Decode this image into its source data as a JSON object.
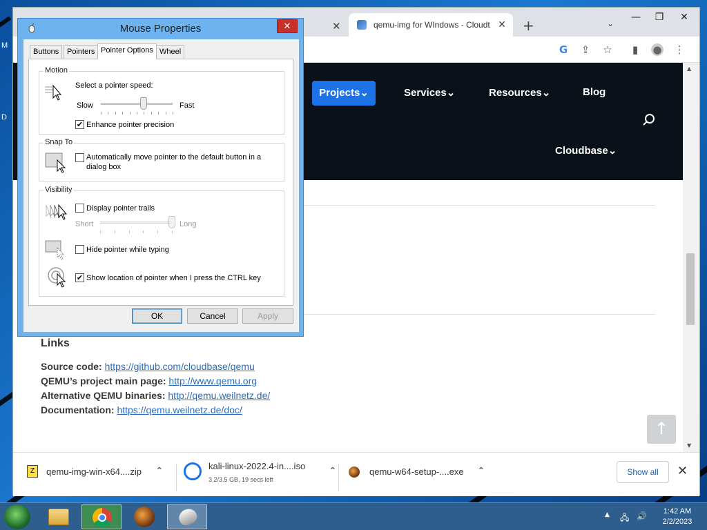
{
  "desktop": {
    "edge_labels": [
      "M",
      "D"
    ]
  },
  "browser": {
    "active_tab_title": "qemu-img for WIndows - Cloudt",
    "colors": {
      "nav_bg": "#0b1118",
      "accent": "#1d72e8",
      "link": "#2a6ebb"
    }
  },
  "site": {
    "nav": {
      "projects": "Projects",
      "services": "Services",
      "resources": "Resources",
      "blog": "Blog",
      "cloudbase": "Cloudbase"
    },
    "links_heading": "Links",
    "links": [
      {
        "label": "Source code:",
        "url": "https://github.com/cloudbase/qemu"
      },
      {
        "label": "QEMU’s project main page:",
        "url": "http://www.qemu.org"
      },
      {
        "label": "Alternative QEMU binaries:",
        "url": "http://qemu.weilnetz.de/"
      },
      {
        "label": "Documentation:",
        "url": "https://qemu.weilnetz.de/doc/"
      }
    ]
  },
  "downloads": {
    "items": [
      {
        "name": "qemu-img-win-x64....zip",
        "status": ""
      },
      {
        "name": "kali-linux-2022.4-in....iso",
        "status": "3.2/3.5 GB, 19 secs left"
      },
      {
        "name": "qemu-w64-setup-....exe",
        "status": ""
      }
    ],
    "show_all": "Show all"
  },
  "dialog": {
    "title": "Mouse Properties",
    "tabs": [
      "Buttons",
      "Pointers",
      "Pointer Options",
      "Wheel"
    ],
    "active_tab": "Pointer Options",
    "motion": {
      "label": "Motion",
      "speed_label": "Select a pointer speed:",
      "slow": "Slow",
      "fast": "Fast",
      "speed_value": 6,
      "speed_max": 10,
      "precision_label": "Enhance pointer precision",
      "precision_checked": true
    },
    "snap_to": {
      "label": "Snap To",
      "option_label": "Automatically move pointer to the default button in a",
      "option_label_2": "dialog box",
      "checked": false
    },
    "visibility": {
      "label": "Visibility",
      "trails_label": "Display pointer trails",
      "trails_checked": false,
      "short": "Short",
      "long": "Long",
      "trail_value": 6,
      "trail_max": 6,
      "hide_label": "Hide pointer while typing",
      "hide_checked": false,
      "ctrl_label": "Show location of pointer when I press the CTRL key",
      "ctrl_checked": true
    },
    "buttons": {
      "ok": "OK",
      "cancel": "Cancel",
      "apply": "Apply"
    }
  },
  "taskbar": {
    "time": "1:42 AM",
    "date": "2/2/2023"
  }
}
